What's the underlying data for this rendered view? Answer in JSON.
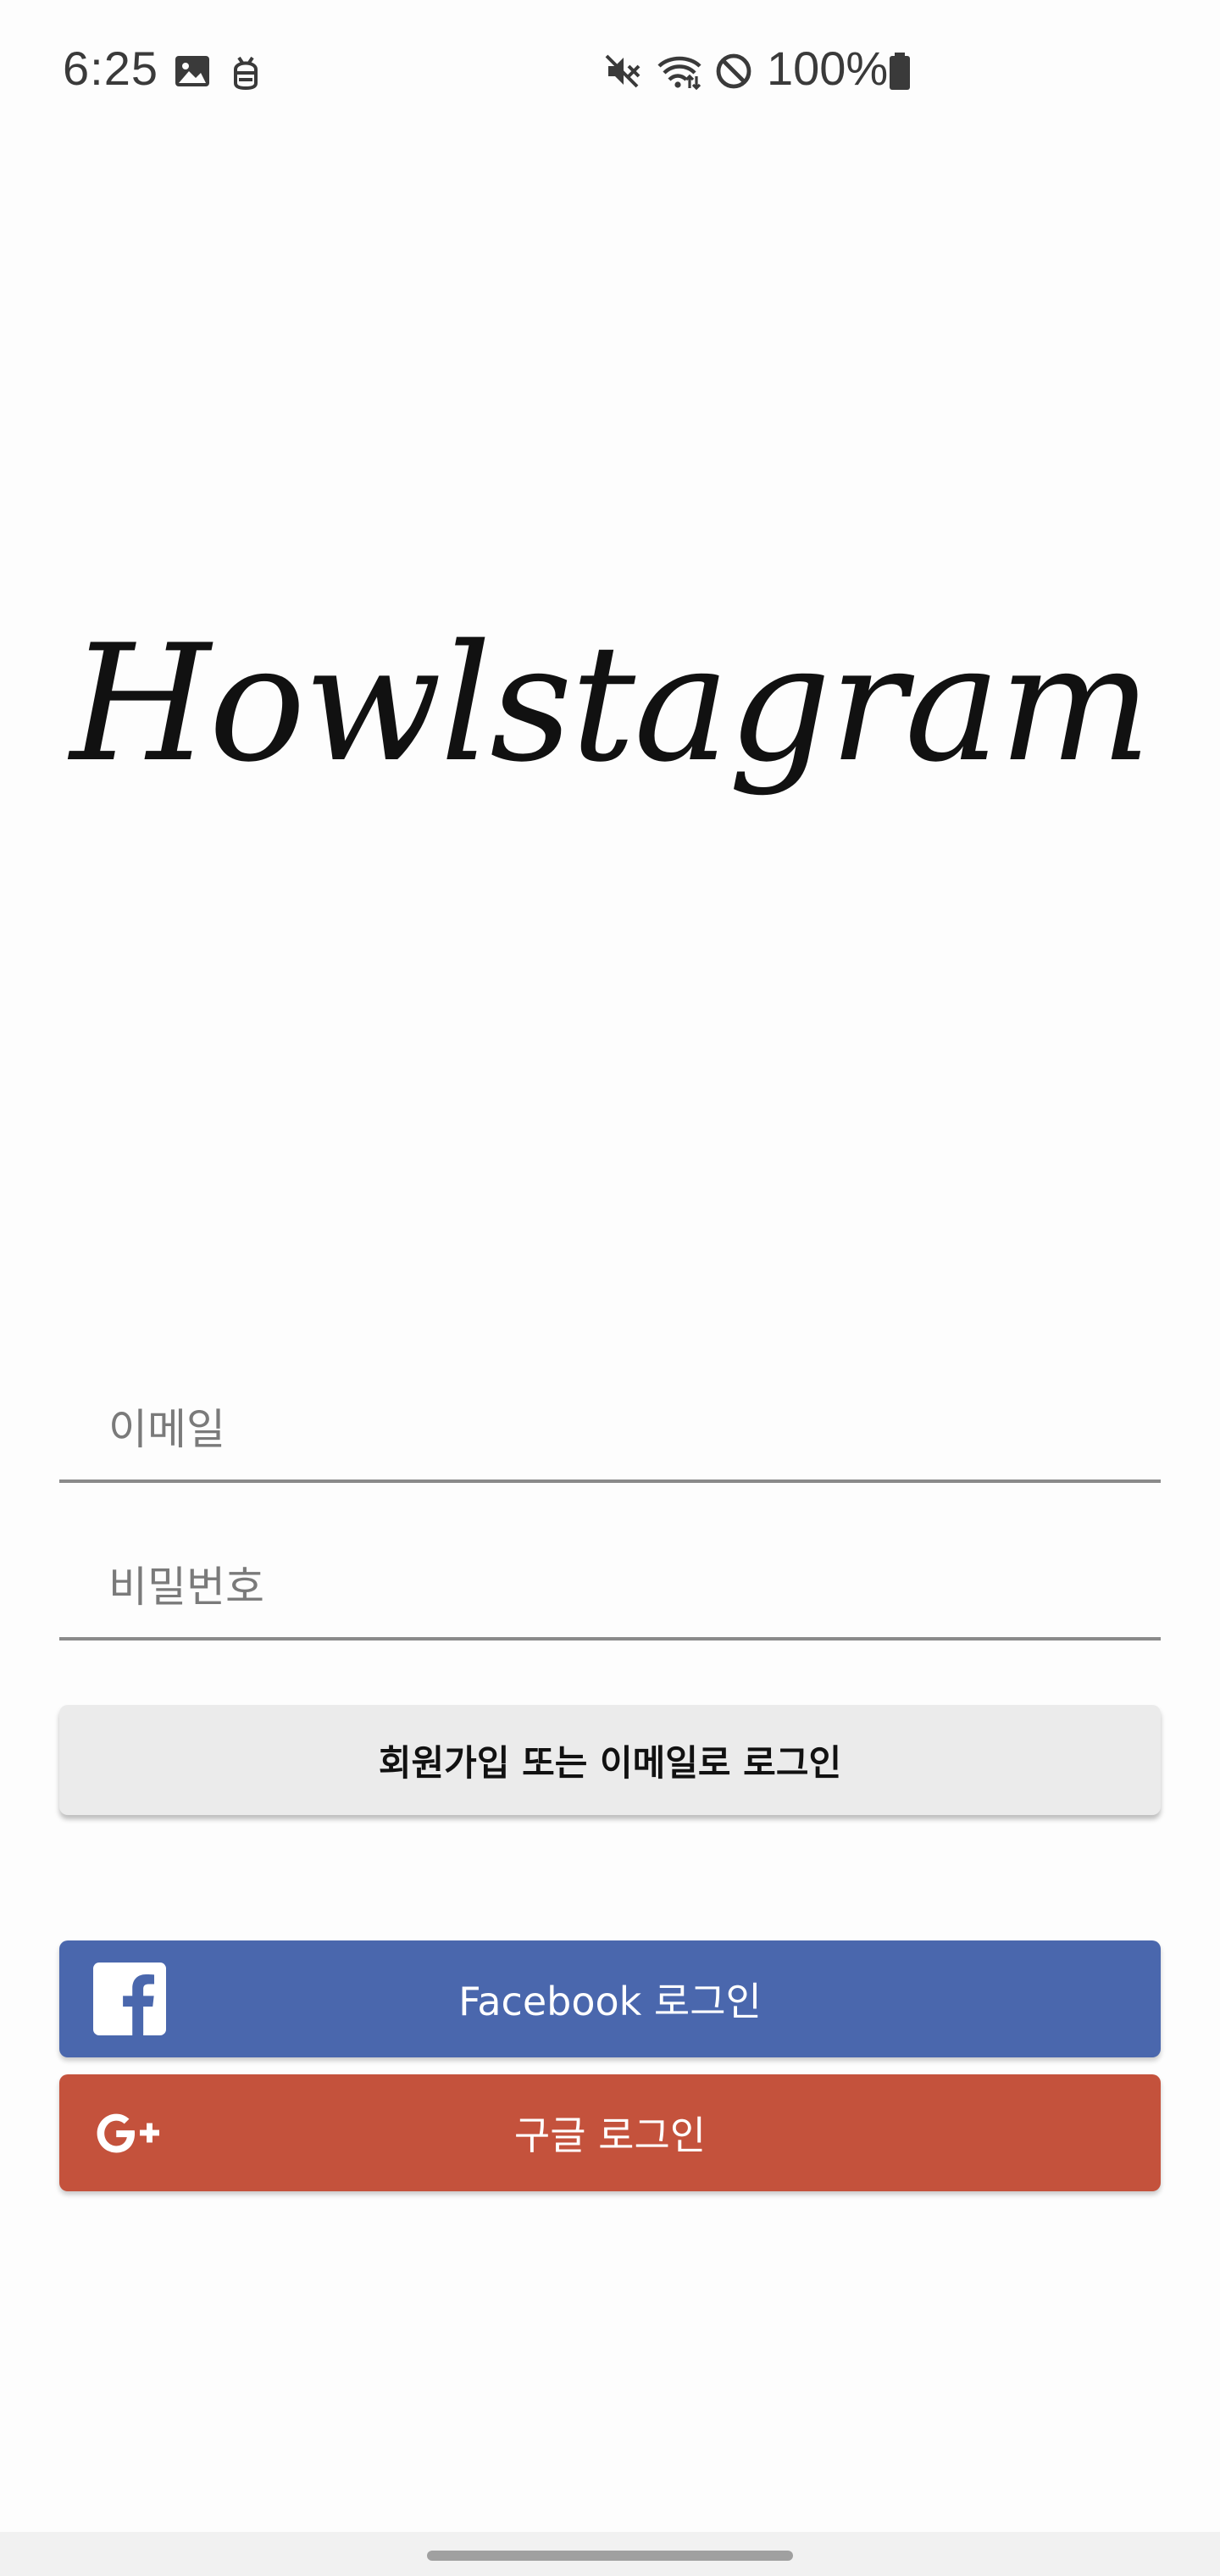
{
  "status_bar": {
    "time": "6:25",
    "battery_percent": "100%",
    "icons": [
      "image-icon",
      "android-debug-icon",
      "mute-icon",
      "wifi-icon",
      "do-not-disturb-icon",
      "battery-icon"
    ]
  },
  "logo": {
    "text": "Howlstagram"
  },
  "form": {
    "email_placeholder": "이메일",
    "email_value": "",
    "password_placeholder": "비밀번호",
    "password_value": "",
    "email_login_label": "회원가입 또는 이메일로 로그인"
  },
  "social": {
    "facebook_label": "Facebook 로그인",
    "facebook_color": "#4a67ad",
    "google_label": "구글 로그인",
    "google_color": "#c4523c"
  }
}
